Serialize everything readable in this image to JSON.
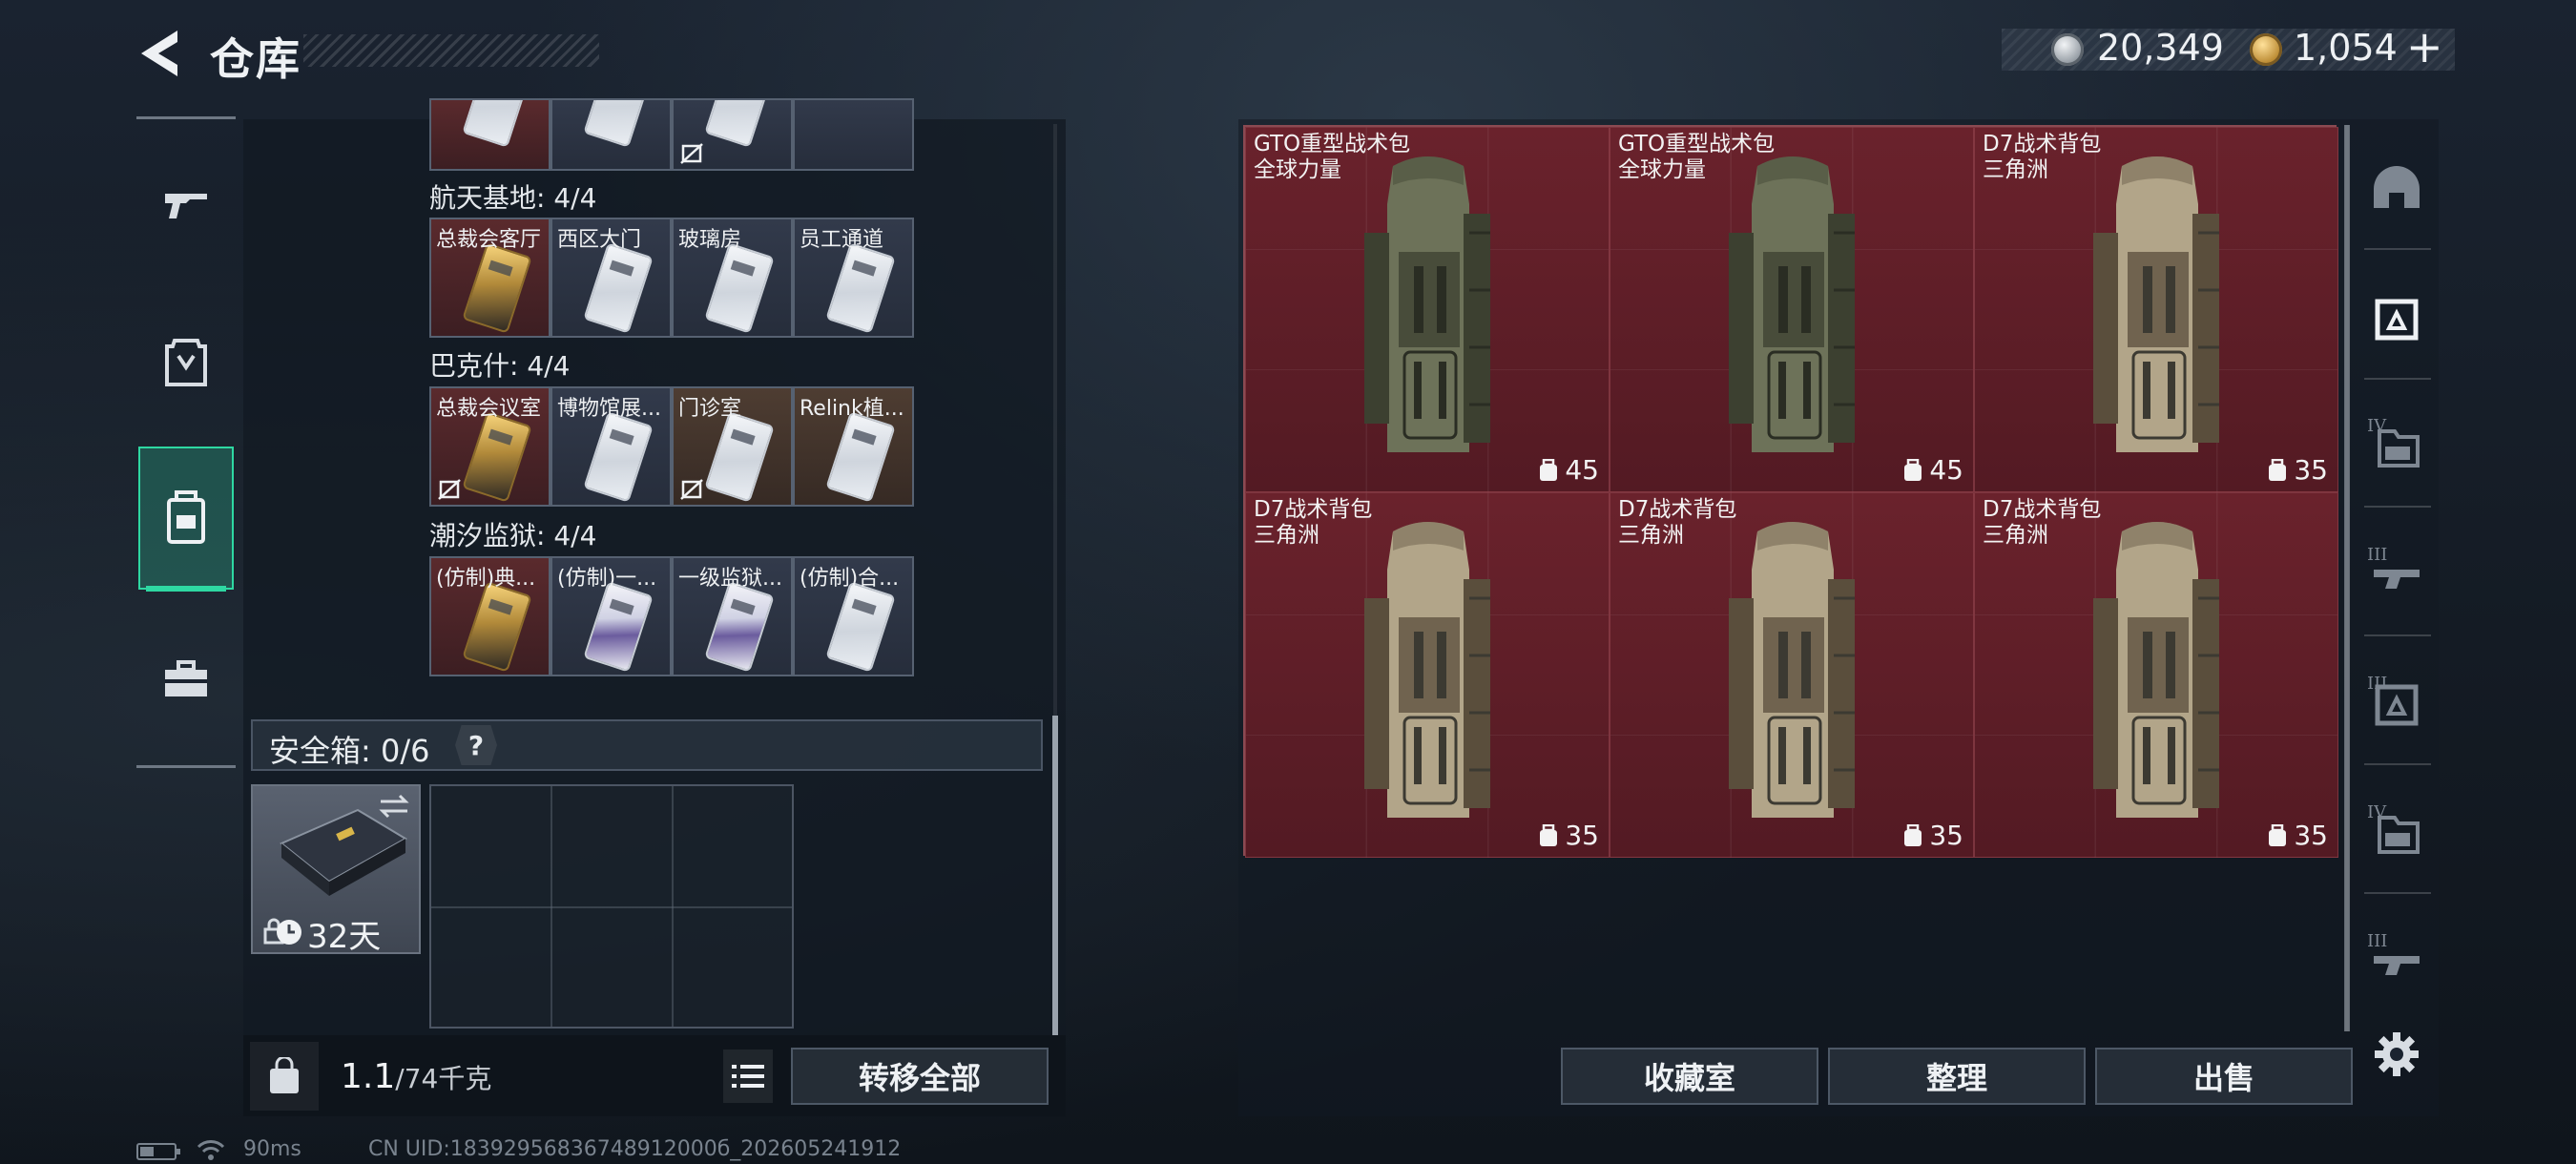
{
  "header": {
    "title": "仓库",
    "currency_silver": "20,349",
    "currency_gold": "1,054",
    "currency_add": "+"
  },
  "left_nav": [
    {
      "name": "weapons",
      "icon": "gun-icon",
      "active": false
    },
    {
      "name": "equipment",
      "icon": "armor-icon",
      "active": false
    },
    {
      "name": "backpack",
      "icon": "backpack-icon",
      "active": true
    },
    {
      "name": "supplies",
      "icon": "toolbox-icon",
      "active": false
    }
  ],
  "keycard_sections": [
    {
      "label": "",
      "cells": [
        {
          "label": "",
          "tone": "red",
          "card": "silver",
          "nolink": false
        },
        {
          "label": "",
          "tone": "blue",
          "card": "silver",
          "nolink": false
        },
        {
          "label": "",
          "tone": "blue",
          "card": "silver",
          "nolink": true
        },
        {
          "label": "",
          "tone": "blue",
          "card": "none",
          "nolink": false
        }
      ]
    },
    {
      "label": "航天基地: 4/4",
      "cells": [
        {
          "label": "总裁会客厅",
          "tone": "red",
          "card": "gold",
          "nolink": false
        },
        {
          "label": "西区大门",
          "tone": "blue",
          "card": "silver",
          "nolink": false
        },
        {
          "label": "玻璃房",
          "tone": "blue",
          "card": "silver",
          "nolink": false
        },
        {
          "label": "员工通道",
          "tone": "blue",
          "card": "silver",
          "nolink": false
        }
      ]
    },
    {
      "label": "巴克什: 4/4",
      "cells": [
        {
          "label": "总裁会议室",
          "tone": "red",
          "card": "gold",
          "nolink": true
        },
        {
          "label": "博物馆展...",
          "tone": "blue",
          "card": "silver",
          "nolink": false
        },
        {
          "label": "门诊室",
          "tone": "brown",
          "card": "silver",
          "nolink": true
        },
        {
          "label": "Relink植...",
          "tone": "brown",
          "card": "silver",
          "nolink": false
        }
      ]
    },
    {
      "label": "潮汐监狱: 4/4",
      "cells": [
        {
          "label": "(仿制)典...",
          "tone": "red",
          "card": "gold",
          "nolink": false
        },
        {
          "label": "(仿制)一...",
          "tone": "blue",
          "card": "purple",
          "nolink": false
        },
        {
          "label": "一级监狱...",
          "tone": "blue",
          "card": "purple",
          "nolink": false
        },
        {
          "label": "(仿制)合...",
          "tone": "blue",
          "card": "silver",
          "nolink": false
        }
      ]
    }
  ],
  "safebox": {
    "label": "安全箱: 0/6",
    "help": "?",
    "duration": "32天"
  },
  "weight": {
    "current": "1.1",
    "max": "/74千克"
  },
  "buttons": {
    "transfer_all": "转移全部",
    "collection_room": "收藏室",
    "organize": "整理",
    "sell": "出售"
  },
  "inventory": [
    {
      "name": "GTO重型战术包",
      "sub": "全球力量",
      "capacity": "45",
      "color": "olive"
    },
    {
      "name": "GTO重型战术包",
      "sub": "全球力量",
      "capacity": "45",
      "color": "olive"
    },
    {
      "name": "D7战术背包",
      "sub": "三角洲",
      "capacity": "35",
      "color": "tan"
    },
    {
      "name": "D7战术背包",
      "sub": "三角洲",
      "capacity": "35",
      "color": "tan"
    },
    {
      "name": "D7战术背包",
      "sub": "三角洲",
      "capacity": "35",
      "color": "tan"
    },
    {
      "name": "D7战术背包",
      "sub": "三角洲",
      "capacity": "35",
      "color": "tan"
    }
  ],
  "right_nav": [
    {
      "name": "helmet",
      "icon": "helmet-icon",
      "tier": ""
    },
    {
      "name": "chest-rig",
      "icon": "chest-rig-icon",
      "tier": ""
    },
    {
      "name": "backpack-t4",
      "icon": "backpack-icon",
      "tier": "IV"
    },
    {
      "name": "weapon-t3",
      "icon": "rifle-icon",
      "tier": "III"
    },
    {
      "name": "rig-t3",
      "icon": "chest-rig-icon",
      "tier": "III"
    },
    {
      "name": "backpack-t4-b",
      "icon": "backpack-icon",
      "tier": "IV"
    },
    {
      "name": "weapon-t3-b",
      "icon": "rifle-icon",
      "tier": "III"
    }
  ],
  "status": {
    "ping": "90ms",
    "uid": "CN UID:18392956836748912000б_202605241912"
  },
  "colors": {
    "accent": "#2ed8a2",
    "inventory_bg": "#5c1c24"
  }
}
